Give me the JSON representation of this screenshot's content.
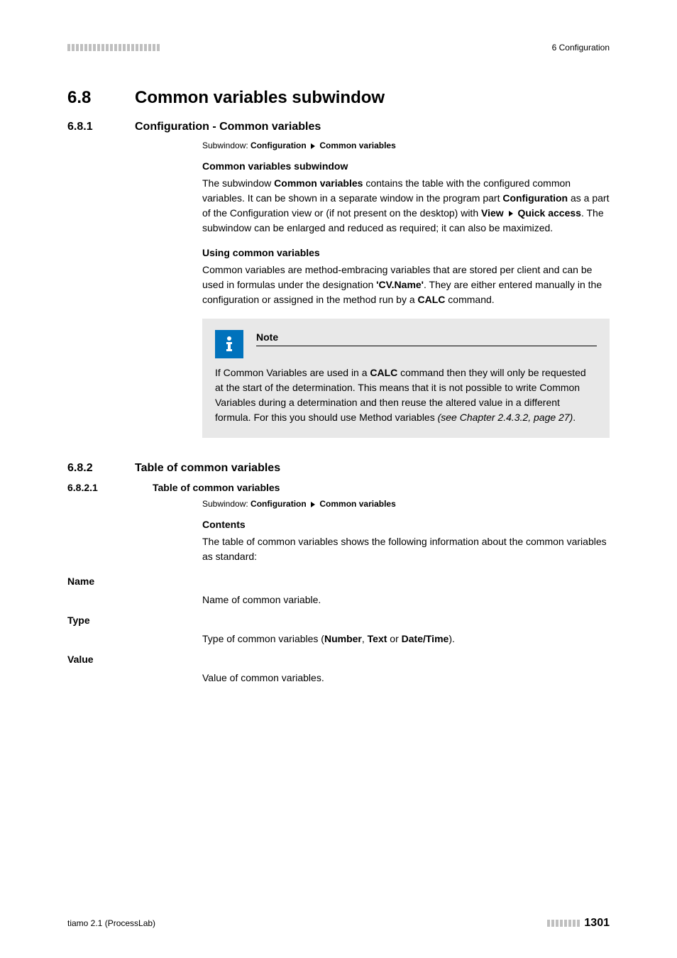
{
  "header": {
    "right": "6 Configuration"
  },
  "section_6_8": {
    "num": "6.8",
    "title": "Common variables subwindow"
  },
  "section_6_8_1": {
    "num": "6.8.1",
    "title": "Configuration - Common variables",
    "subwindow_prefix": "Subwindow: ",
    "subwindow_a": "Configuration",
    "subwindow_b": "Common variables",
    "sub1_head": "Common variables subwindow",
    "sub1_p1a": "The subwindow ",
    "sub1_p1b": "Common variables",
    "sub1_p1c": " contains the table with the configured common variables. It can be shown in a separate window in the program part ",
    "sub1_p1d": "Configuration",
    "sub1_p1e": " as a part of the Configuration view or (if not present on the desktop) with ",
    "sub1_p1f": "View",
    "sub1_p1g": "Quick access",
    "sub1_p1h": ". The subwindow can be enlarged and reduced as required; it can also be maximized.",
    "sub2_head": "Using common variables",
    "sub2_p1a": "Common variables are method-embracing variables that are stored per client and can be used in formulas under the designation ",
    "sub2_p1b": "'CV.Name'",
    "sub2_p1c": ". They are either entered manually in the configuration or assigned in the method run by a ",
    "sub2_p1d": "CALC",
    "sub2_p1e": " command.",
    "note_title": "Note",
    "note_a": "If Common Variables are used in a ",
    "note_b": "CALC",
    "note_c": " command then they will only be requested at the start of the determination. This means that it is not possible to write Common Variables during a determination and then reuse the altered value in a different formula. For this you should use Method variables ",
    "note_d": "(see Chapter 2.4.3.2, page 27)",
    "note_e": "."
  },
  "section_6_8_2": {
    "num": "6.8.2",
    "title": "Table of common variables"
  },
  "section_6_8_2_1": {
    "num": "6.8.2.1",
    "title": "Table of common variables",
    "subwindow_prefix": "Subwindow: ",
    "subwindow_a": "Configuration",
    "subwindow_b": "Common variables",
    "contents_head": "Contents",
    "contents_p": "The table of common variables shows the following information about the common variables as standard:",
    "fields": {
      "name_label": "Name",
      "name_desc": "Name of common variable.",
      "type_label": "Type",
      "type_desc_a": "Type of common variables (",
      "type_desc_b": "Number",
      "type_desc_c": ", ",
      "type_desc_d": "Text",
      "type_desc_e": " or ",
      "type_desc_f": "Date/Time",
      "type_desc_g": ").",
      "value_label": "Value",
      "value_desc": "Value of common variables."
    }
  },
  "footer": {
    "left": "tiamo 2.1 (ProcessLab)",
    "page": "1301"
  }
}
